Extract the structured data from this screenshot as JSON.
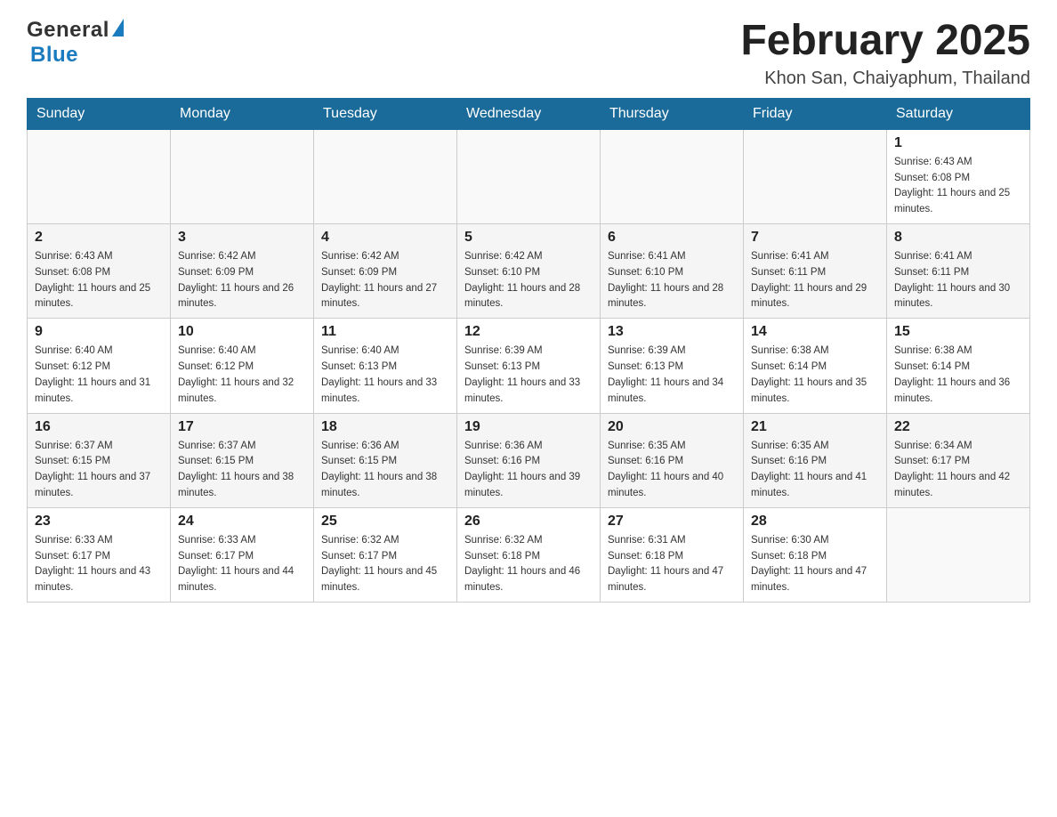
{
  "header": {
    "logo_general": "General",
    "logo_blue": "Blue",
    "month_title": "February 2025",
    "location": "Khon San, Chaiyaphum, Thailand"
  },
  "days_of_week": [
    "Sunday",
    "Monday",
    "Tuesday",
    "Wednesday",
    "Thursday",
    "Friday",
    "Saturday"
  ],
  "weeks": [
    [
      {
        "day": "",
        "sunrise": "",
        "sunset": "",
        "daylight": ""
      },
      {
        "day": "",
        "sunrise": "",
        "sunset": "",
        "daylight": ""
      },
      {
        "day": "",
        "sunrise": "",
        "sunset": "",
        "daylight": ""
      },
      {
        "day": "",
        "sunrise": "",
        "sunset": "",
        "daylight": ""
      },
      {
        "day": "",
        "sunrise": "",
        "sunset": "",
        "daylight": ""
      },
      {
        "day": "",
        "sunrise": "",
        "sunset": "",
        "daylight": ""
      },
      {
        "day": "1",
        "sunrise": "Sunrise: 6:43 AM",
        "sunset": "Sunset: 6:08 PM",
        "daylight": "Daylight: 11 hours and 25 minutes."
      }
    ],
    [
      {
        "day": "2",
        "sunrise": "Sunrise: 6:43 AM",
        "sunset": "Sunset: 6:08 PM",
        "daylight": "Daylight: 11 hours and 25 minutes."
      },
      {
        "day": "3",
        "sunrise": "Sunrise: 6:42 AM",
        "sunset": "Sunset: 6:09 PM",
        "daylight": "Daylight: 11 hours and 26 minutes."
      },
      {
        "day": "4",
        "sunrise": "Sunrise: 6:42 AM",
        "sunset": "Sunset: 6:09 PM",
        "daylight": "Daylight: 11 hours and 27 minutes."
      },
      {
        "day": "5",
        "sunrise": "Sunrise: 6:42 AM",
        "sunset": "Sunset: 6:10 PM",
        "daylight": "Daylight: 11 hours and 28 minutes."
      },
      {
        "day": "6",
        "sunrise": "Sunrise: 6:41 AM",
        "sunset": "Sunset: 6:10 PM",
        "daylight": "Daylight: 11 hours and 28 minutes."
      },
      {
        "day": "7",
        "sunrise": "Sunrise: 6:41 AM",
        "sunset": "Sunset: 6:11 PM",
        "daylight": "Daylight: 11 hours and 29 minutes."
      },
      {
        "day": "8",
        "sunrise": "Sunrise: 6:41 AM",
        "sunset": "Sunset: 6:11 PM",
        "daylight": "Daylight: 11 hours and 30 minutes."
      }
    ],
    [
      {
        "day": "9",
        "sunrise": "Sunrise: 6:40 AM",
        "sunset": "Sunset: 6:12 PM",
        "daylight": "Daylight: 11 hours and 31 minutes."
      },
      {
        "day": "10",
        "sunrise": "Sunrise: 6:40 AM",
        "sunset": "Sunset: 6:12 PM",
        "daylight": "Daylight: 11 hours and 32 minutes."
      },
      {
        "day": "11",
        "sunrise": "Sunrise: 6:40 AM",
        "sunset": "Sunset: 6:13 PM",
        "daylight": "Daylight: 11 hours and 33 minutes."
      },
      {
        "day": "12",
        "sunrise": "Sunrise: 6:39 AM",
        "sunset": "Sunset: 6:13 PM",
        "daylight": "Daylight: 11 hours and 33 minutes."
      },
      {
        "day": "13",
        "sunrise": "Sunrise: 6:39 AM",
        "sunset": "Sunset: 6:13 PM",
        "daylight": "Daylight: 11 hours and 34 minutes."
      },
      {
        "day": "14",
        "sunrise": "Sunrise: 6:38 AM",
        "sunset": "Sunset: 6:14 PM",
        "daylight": "Daylight: 11 hours and 35 minutes."
      },
      {
        "day": "15",
        "sunrise": "Sunrise: 6:38 AM",
        "sunset": "Sunset: 6:14 PM",
        "daylight": "Daylight: 11 hours and 36 minutes."
      }
    ],
    [
      {
        "day": "16",
        "sunrise": "Sunrise: 6:37 AM",
        "sunset": "Sunset: 6:15 PM",
        "daylight": "Daylight: 11 hours and 37 minutes."
      },
      {
        "day": "17",
        "sunrise": "Sunrise: 6:37 AM",
        "sunset": "Sunset: 6:15 PM",
        "daylight": "Daylight: 11 hours and 38 minutes."
      },
      {
        "day": "18",
        "sunrise": "Sunrise: 6:36 AM",
        "sunset": "Sunset: 6:15 PM",
        "daylight": "Daylight: 11 hours and 38 minutes."
      },
      {
        "day": "19",
        "sunrise": "Sunrise: 6:36 AM",
        "sunset": "Sunset: 6:16 PM",
        "daylight": "Daylight: 11 hours and 39 minutes."
      },
      {
        "day": "20",
        "sunrise": "Sunrise: 6:35 AM",
        "sunset": "Sunset: 6:16 PM",
        "daylight": "Daylight: 11 hours and 40 minutes."
      },
      {
        "day": "21",
        "sunrise": "Sunrise: 6:35 AM",
        "sunset": "Sunset: 6:16 PM",
        "daylight": "Daylight: 11 hours and 41 minutes."
      },
      {
        "day": "22",
        "sunrise": "Sunrise: 6:34 AM",
        "sunset": "Sunset: 6:17 PM",
        "daylight": "Daylight: 11 hours and 42 minutes."
      }
    ],
    [
      {
        "day": "23",
        "sunrise": "Sunrise: 6:33 AM",
        "sunset": "Sunset: 6:17 PM",
        "daylight": "Daylight: 11 hours and 43 minutes."
      },
      {
        "day": "24",
        "sunrise": "Sunrise: 6:33 AM",
        "sunset": "Sunset: 6:17 PM",
        "daylight": "Daylight: 11 hours and 44 minutes."
      },
      {
        "day": "25",
        "sunrise": "Sunrise: 6:32 AM",
        "sunset": "Sunset: 6:17 PM",
        "daylight": "Daylight: 11 hours and 45 minutes."
      },
      {
        "day": "26",
        "sunrise": "Sunrise: 6:32 AM",
        "sunset": "Sunset: 6:18 PM",
        "daylight": "Daylight: 11 hours and 46 minutes."
      },
      {
        "day": "27",
        "sunrise": "Sunrise: 6:31 AM",
        "sunset": "Sunset: 6:18 PM",
        "daylight": "Daylight: 11 hours and 47 minutes."
      },
      {
        "day": "28",
        "sunrise": "Sunrise: 6:30 AM",
        "sunset": "Sunset: 6:18 PM",
        "daylight": "Daylight: 11 hours and 47 minutes."
      },
      {
        "day": "",
        "sunrise": "",
        "sunset": "",
        "daylight": ""
      }
    ]
  ]
}
